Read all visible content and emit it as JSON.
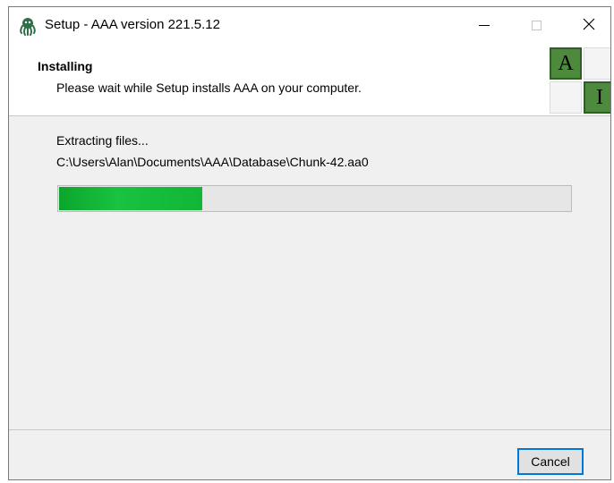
{
  "window": {
    "title": "Setup - AAA version 221.5.12",
    "controls": {
      "minimize": "minimize",
      "maximize": "maximize",
      "close": "close"
    }
  },
  "header": {
    "title": "Installing",
    "subtitle": "Please wait while Setup installs AAA on your computer.",
    "logo_tiles": [
      "A",
      "I"
    ]
  },
  "main": {
    "status": "Extracting files...",
    "current_file": "C:\\Users\\Alan\\Documents\\AAA\\Database\\Chunk-42.aa0",
    "progress_fraction": 0.28
  },
  "footer": {
    "cancel_label": "Cancel"
  },
  "colors": {
    "accent": "#0078d7",
    "progress": "#16b83a",
    "logo_green": "#4e8a3e"
  },
  "icons": {
    "app": "octopus-icon",
    "close": "close-icon",
    "minimize": "minimize-icon",
    "maximize": "maximize-icon"
  }
}
